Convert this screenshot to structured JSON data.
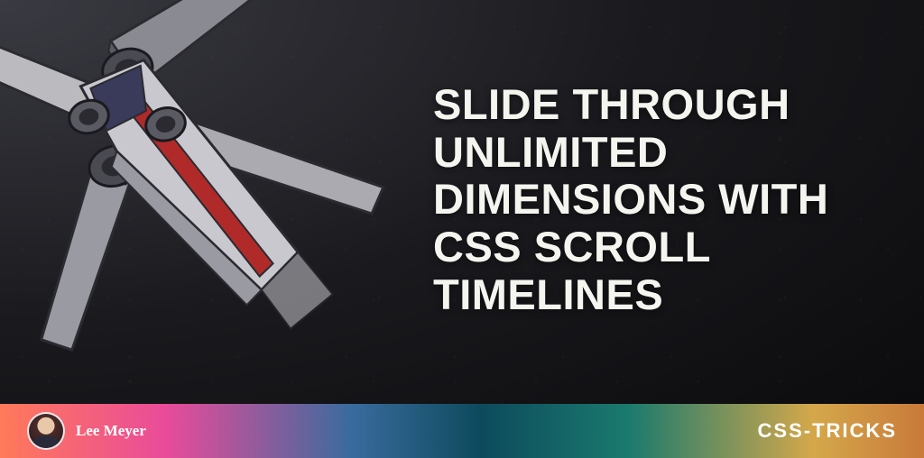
{
  "article": {
    "title": "SLIDE THROUGH UNLIMITED DIMENSIONS WITH CSS SCROLL TIMELINES"
  },
  "author": {
    "name": "Lee Meyer"
  },
  "brand": {
    "name": "CSS-TRICKS"
  },
  "colors": {
    "text": "#f5f5f0",
    "gradient": [
      "#ff7a59",
      "#e94b9a",
      "#3a6b9e",
      "#0d4a5c",
      "#1a7a6e",
      "#d4a84a",
      "#c97a3a"
    ]
  },
  "illustration": {
    "description": "xwing-spaceship"
  }
}
